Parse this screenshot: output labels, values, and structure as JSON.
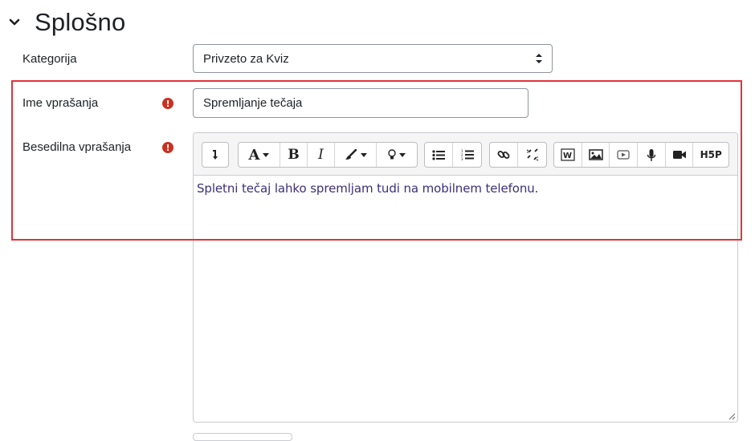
{
  "section": {
    "title": "Splošno",
    "icon": "chevron-down-icon"
  },
  "fields": {
    "category": {
      "label": "Kategorija",
      "value": "Privzeto za Kviz"
    },
    "question_name": {
      "label": "Ime vprašanja",
      "value": "Spremljanje tečaja",
      "required_icon": "exclamation-circle-icon"
    },
    "question_text": {
      "label": "Besedilna vprašanja",
      "required_icon": "exclamation-circle-icon",
      "content": "Spletni tečaj lahko spremljam tudi na mobilnem telefonu."
    }
  },
  "toolbar": {
    "groups": [
      [
        "toolbar-toggle-icon"
      ],
      [
        "font-icon",
        "bold-icon",
        "italic-icon",
        "paintbrush-icon",
        "lightbulb-icon"
      ],
      [
        "bullet-list-icon",
        "numbered-list-icon"
      ],
      [
        "link-icon",
        "unlink-icon"
      ],
      [
        "word-import-icon",
        "image-icon",
        "media-icon",
        "microphone-icon",
        "video-icon",
        "h5p-icon"
      ]
    ],
    "bold_label": "B",
    "italic_label": "I",
    "font_label": "A",
    "word_label": "W",
    "h5p_label": "H5P"
  },
  "colors": {
    "highlight": "#e0343b",
    "required": "#ca3120",
    "editor_text": "#3d2f7a"
  }
}
